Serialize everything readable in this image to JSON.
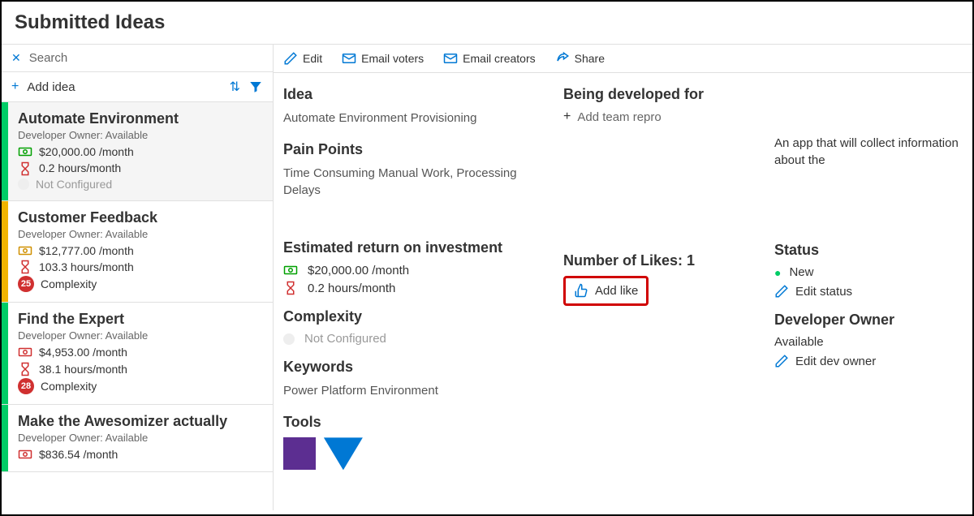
{
  "header": {
    "title": "Submitted Ideas"
  },
  "search": {
    "placeholder": "Search"
  },
  "add_idea": {
    "label": "Add idea"
  },
  "toolbar": {
    "edit": "Edit",
    "email_voters": "Email voters",
    "email_creators": "Email creators",
    "share": "Share"
  },
  "ideas": [
    {
      "title": "Automate Environment",
      "owner": "Developer Owner: Available",
      "money": "$20,000.00 /month",
      "hours": "0.2 hours/month",
      "complexity_label": "Not Configured",
      "bar_color": "green",
      "money_color": "green",
      "complexity_type": "notconf",
      "selected": true
    },
    {
      "title": "Customer Feedback",
      "owner": "Developer Owner: Available",
      "money": "$12,777.00 /month",
      "hours": "103.3 hours/month",
      "complexity_label": "Complexity",
      "complexity_badge": "25",
      "bar_color": "yellow",
      "money_color": "yellow",
      "complexity_type": "badge",
      "selected": false
    },
    {
      "title": "Find the Expert",
      "owner": "Developer Owner: Available",
      "money": "$4,953.00 /month",
      "hours": "38.1 hours/month",
      "complexity_label": "Complexity",
      "complexity_badge": "28",
      "bar_color": "green",
      "money_color": "red",
      "complexity_type": "badge",
      "selected": false
    },
    {
      "title": "Make the Awesomizer actually",
      "owner": "Developer Owner: Available",
      "money": "$836.54 /month",
      "hours": "",
      "complexity_label": "",
      "bar_color": "green",
      "money_color": "red",
      "complexity_type": "none",
      "selected": false
    }
  ],
  "detail": {
    "idea_label": "Idea",
    "idea_value": "Automate Environment Provisioning",
    "pain_label": "Pain Points",
    "pain_value": "Time Consuming Manual Work, Processing Delays",
    "roi_label": "Estimated return on investment",
    "roi_money": "$20,000.00 /month",
    "roi_hours": "0.2 hours/month",
    "complexity_label": "Complexity",
    "complexity_value": "Not Configured",
    "keywords_label": "Keywords",
    "keywords_value": "Power Platform Environment",
    "tools_label": "Tools",
    "being_dev_label": "Being developed for",
    "add_team": "Add team repro",
    "likes_label": "Number of Likes: 1",
    "add_like": "Add like",
    "description": "An app that will collect information about the",
    "status_label": "Status",
    "status_value": "New",
    "edit_status": "Edit status",
    "dev_owner_label": "Developer Owner",
    "dev_owner_value": "Available",
    "edit_dev_owner": "Edit dev owner"
  }
}
